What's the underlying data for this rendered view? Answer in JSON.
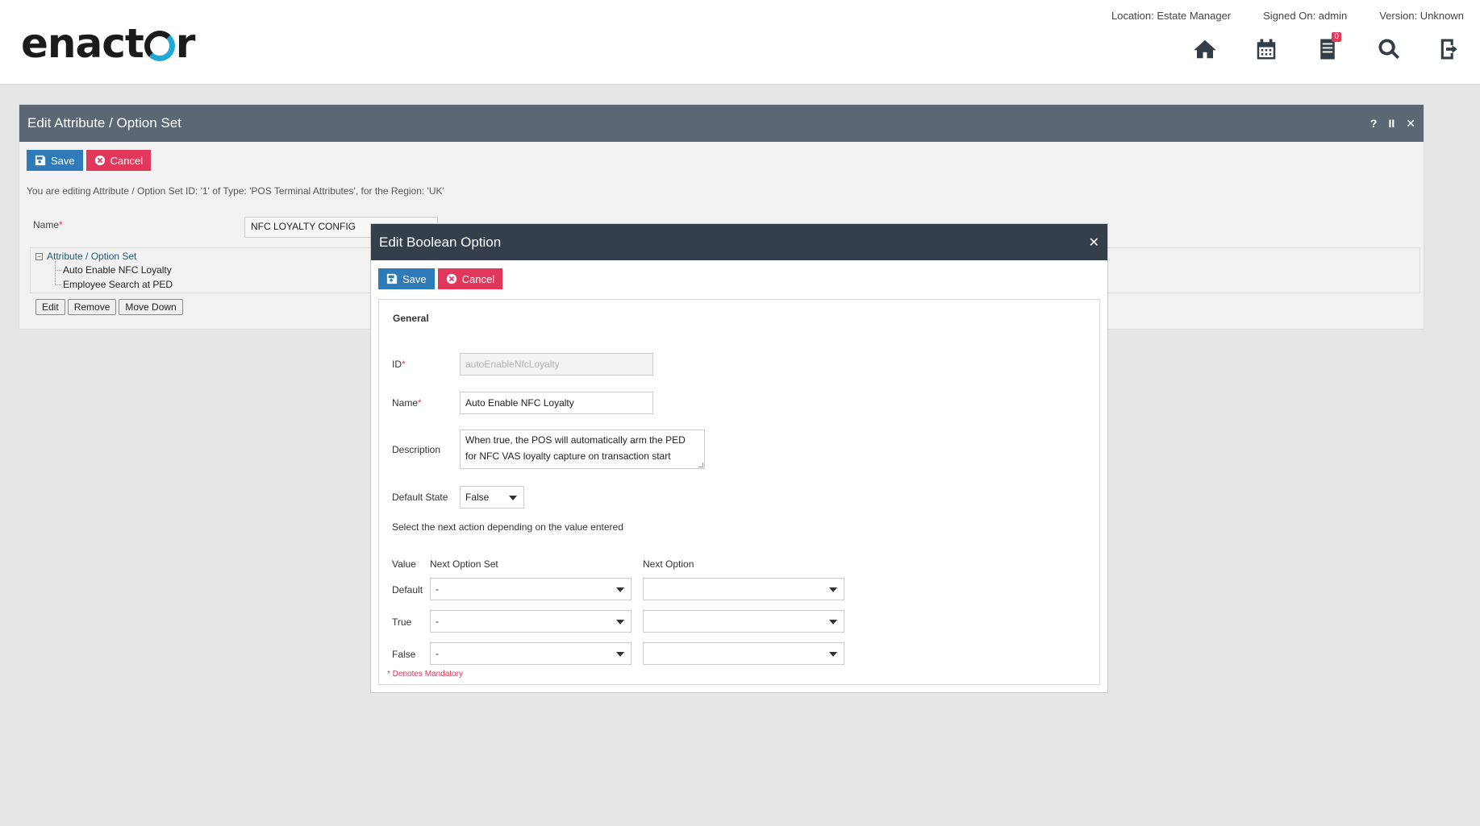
{
  "header": {
    "logo": "enact",
    "logo_tail": "r",
    "location": "Location: Estate Manager",
    "signed_on": "Signed On: admin",
    "version": "Version: Unknown",
    "icons": [
      "home-icon",
      "calendar-icon",
      "document-list-icon",
      "search-icon",
      "logout-icon"
    ],
    "notification_count": "0"
  },
  "panel": {
    "title": "Edit Attribute / Option Set",
    "controls": {
      "help": "?",
      "pause": "II",
      "close": "✕"
    },
    "save_label": "Save",
    "cancel_label": "Cancel",
    "info": "You are editing Attribute / Option Set ID: '1' of Type: 'POS Terminal Attributes', for the Region: 'UK'",
    "name_label": "Name",
    "name_required": "*",
    "name_value": "NFC LOYALTY CONFIG",
    "tree": {
      "toggle": "−",
      "root_label": "Attribute / Option Set",
      "items": [
        "Auto Enable NFC Loyalty",
        "Employee Search at PED"
      ]
    },
    "tree_buttons": {
      "edit": "Edit",
      "remove": "Remove",
      "move_down": "Move Down"
    }
  },
  "dialog": {
    "title": "Edit Boolean Option",
    "close": "✕",
    "save_label": "Save",
    "cancel_label": "Cancel",
    "section": "General",
    "id_label": "ID",
    "id_value": "autoEnableNfcLoyalty",
    "name_label": "Name",
    "name_value": "Auto Enable NFC Loyalty",
    "required": "*",
    "description_label": "Description",
    "description_line1": "When true, the POS will automatically arm the PED",
    "description_line2": "for NFC VAS loyalty capture on transaction start",
    "default_state_label": "Default State",
    "default_state_value": "False",
    "help": "Select the next action depending on the value entered",
    "columns": {
      "value": "Value",
      "next_option_set": "Next Option Set",
      "next_option": "Next Option"
    },
    "rows": [
      {
        "label": "Default",
        "option_set": "-",
        "option": ""
      },
      {
        "label": "True",
        "option_set": "-",
        "option": ""
      },
      {
        "label": "False",
        "option_set": "-",
        "option": ""
      }
    ],
    "mandatory_note": "* Denotes Mandatory"
  },
  "colors": {
    "save": "#2f7ab8",
    "cancel": "#e2375b",
    "panel_title": "#5b6772",
    "dialog_title": "#343f4b"
  }
}
